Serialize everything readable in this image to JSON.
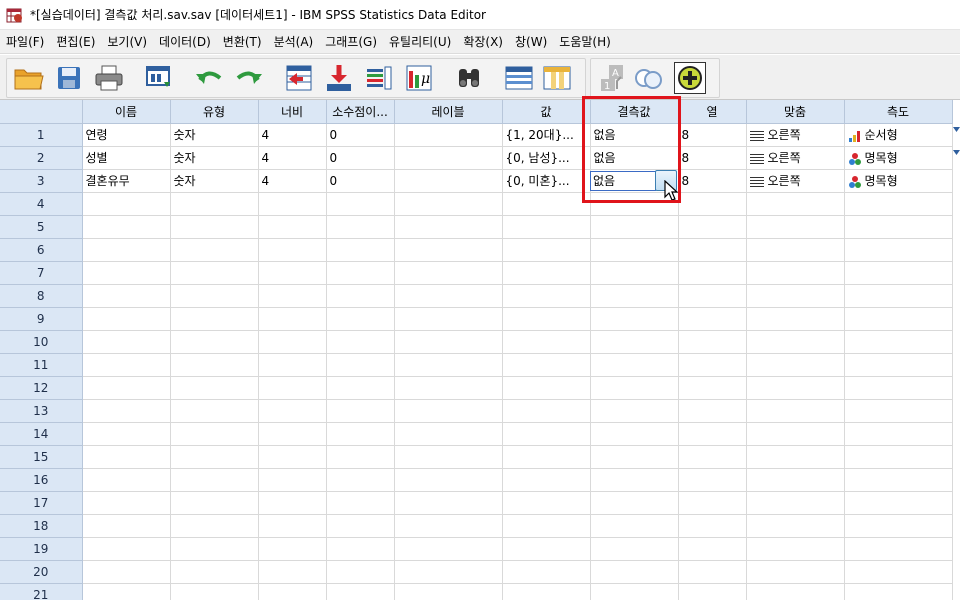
{
  "window": {
    "title": "*[실습데이터] 결측값 처리.sav.sav [데이터세트1] - IBM SPSS Statistics Data Editor"
  },
  "menu": [
    {
      "label": "파일(F)"
    },
    {
      "label": "편집(E)"
    },
    {
      "label": "보기(V)"
    },
    {
      "label": "데이터(D)"
    },
    {
      "label": "변환(T)"
    },
    {
      "label": "분석(A)"
    },
    {
      "label": "그래프(G)"
    },
    {
      "label": "유틸리티(U)"
    },
    {
      "label": "확장(X)"
    },
    {
      "label": "창(W)"
    },
    {
      "label": "도움말(H)"
    }
  ],
  "toolbar": {
    "buttons": [
      {
        "icon": "open-folder-icon"
      },
      {
        "icon": "save-icon"
      },
      {
        "icon": "print-icon"
      },
      {
        "icon": "dialog-recall-icon"
      },
      {
        "icon": "undo-icon"
      },
      {
        "icon": "redo-icon"
      },
      {
        "icon": "goto-case-icon"
      },
      {
        "icon": "goto-variable-icon"
      },
      {
        "icon": "variables-icon"
      },
      {
        "icon": "run-descriptives-icon"
      },
      {
        "icon": "find-icon"
      },
      {
        "icon": "insert-cases-icon"
      },
      {
        "icon": "insert-variable-icon"
      },
      {
        "icon": "split-file-icon"
      },
      {
        "icon": "value-labels-icon"
      },
      {
        "icon": "use-variable-sets-icon"
      }
    ]
  },
  "grid": {
    "columns": [
      "이름",
      "유형",
      "너비",
      "소수점이...",
      "레이블",
      "값",
      "결측값",
      "열",
      "맞춤",
      "측도"
    ],
    "rows": [
      {
        "num": "1",
        "name": "연령",
        "type": "숫자",
        "width": "4",
        "decimals": "0",
        "label": "",
        "values": "{1, 20대}...",
        "missing": "없음",
        "columns": "8",
        "align": "오른쪽",
        "measure": "순서형",
        "measure_kind": "ordinal"
      },
      {
        "num": "2",
        "name": "성별",
        "type": "숫자",
        "width": "4",
        "decimals": "0",
        "label": "",
        "values": "{0, 남성}...",
        "missing": "없음",
        "columns": "8",
        "align": "오른쪽",
        "measure": "명목형",
        "measure_kind": "nominal"
      },
      {
        "num": "3",
        "name": "결혼유무",
        "type": "숫자",
        "width": "4",
        "decimals": "0",
        "label": "",
        "values": "{0, 미혼}...",
        "missing": "없음",
        "columns": "8",
        "align": "오른쪽",
        "measure": "명목형",
        "measure_kind": "nominal"
      }
    ],
    "empty_row_numbers": [
      "4",
      "5",
      "6",
      "7",
      "8",
      "9",
      "10",
      "11",
      "12",
      "13",
      "14",
      "15",
      "16",
      "17",
      "18",
      "19",
      "20",
      "21"
    ]
  },
  "colors": {
    "header_bg": "#dbe7f5",
    "highlight": "#e0141b"
  }
}
